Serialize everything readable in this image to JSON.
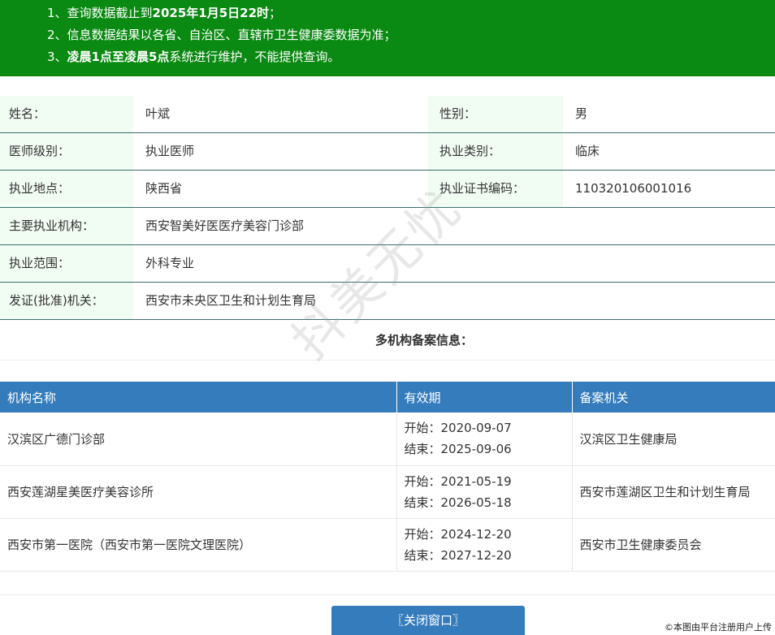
{
  "notice": {
    "line1_prefix": "1、查询数据截止到",
    "line1_bold": "2025年1月5日22时",
    "line1_suffix": "；",
    "line2": "2、信息数据结果以各省、自治区、直辖市卫生健康委数据为准；",
    "line3_prefix": "3、",
    "line3_bold": "凌晨1点至凌晨5点",
    "line3_suffix": "系统进行维护，不能提供查询。"
  },
  "doctor": {
    "name_label": "姓名：",
    "name": "叶斌",
    "gender_label": "性别：",
    "gender": "男",
    "level_label": "医师级别：",
    "level": "执业医师",
    "category_label": "执业类别：",
    "category": "临床",
    "location_label": "执业地点：",
    "location": "陕西省",
    "cert_label": "执业证书编码：",
    "cert": "110320106001016",
    "institution_label": "主要执业机构：",
    "institution": "西安智美好医医疗美容门诊部",
    "scope_label": "执业范围：",
    "scope": "外科专业",
    "issuer_label": "发证(批准)机关：",
    "issuer": "西安市未央区卫生和计划生育局"
  },
  "multi_title": "多机构备案信息：",
  "org_table": {
    "headers": [
      "机构名称",
      "有效期",
      "备案机关"
    ],
    "rows": [
      {
        "name": "汉滨区广德门诊部",
        "start": "开始：2020-09-07",
        "end": "结束：2025-09-06",
        "authority": "汉滨区卫生健康局"
      },
      {
        "name": "西安莲湖星美医疗美容诊所",
        "start": "开始：2021-05-19",
        "end": "结束：2026-05-18",
        "authority": "西安市莲湖区卫生和计划生育局"
      },
      {
        "name": "西安市第一医院（西安市第一医院文理医院）",
        "start": "开始：2024-12-20",
        "end": "结束：2027-12-20",
        "authority": "西安市卫生健康委员会"
      }
    ]
  },
  "close_button": "〖关闭窗口〗",
  "watermark": "抖美无忧",
  "credit": "©本图由平台注册用户上传",
  "colors": {
    "banner": "#0a8a12",
    "label_bg": "#f1fcf3",
    "table_header": "#357cbc",
    "button": "#357cbc"
  }
}
